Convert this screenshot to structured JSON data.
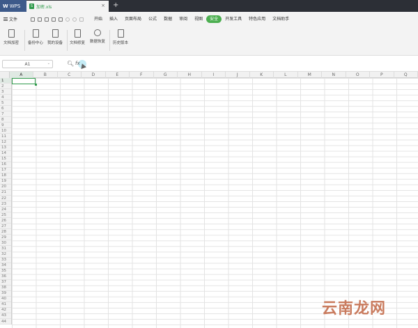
{
  "app": {
    "name": "WPS"
  },
  "tabs": {
    "doc_name": "加密.xls",
    "new_tab": "+",
    "close": "×"
  },
  "menu": {
    "file": "文件",
    "items": [
      "开始",
      "插入",
      "页面布局",
      "公式",
      "数据",
      "审阅",
      "视图",
      "安全",
      "开发工具",
      "特色应用",
      "文档助手"
    ],
    "active_index": 7,
    "active_color": "#4caf50"
  },
  "ribbon": {
    "buttons": [
      "文档加密",
      "备份中心",
      "我的设备",
      "文档修复",
      "数据恢复",
      "历史版本"
    ]
  },
  "formula_bar": {
    "cell_ref": "A1",
    "fx": "fx",
    "zoom_icon": "search-icon"
  },
  "grid": {
    "columns": [
      "A",
      "B",
      "C",
      "D",
      "E",
      "F",
      "G",
      "H",
      "I",
      "J",
      "K",
      "L",
      "M",
      "N",
      "O",
      "P",
      "Q"
    ],
    "rows": [
      "1",
      "2",
      "3",
      "4",
      "5",
      "6",
      "7",
      "8",
      "9",
      "10",
      "11",
      "12",
      "13",
      "14",
      "15",
      "16",
      "17",
      "18",
      "19",
      "20",
      "21",
      "22",
      "23",
      "24",
      "25",
      "26",
      "27",
      "28",
      "29",
      "30",
      "31",
      "32",
      "33",
      "34",
      "35",
      "36",
      "37",
      "38",
      "39",
      "40",
      "41",
      "42",
      "43",
      "44"
    ],
    "selected_cell": "A1",
    "selection_color": "#2f9a4b"
  },
  "watermark": "云南龙网"
}
